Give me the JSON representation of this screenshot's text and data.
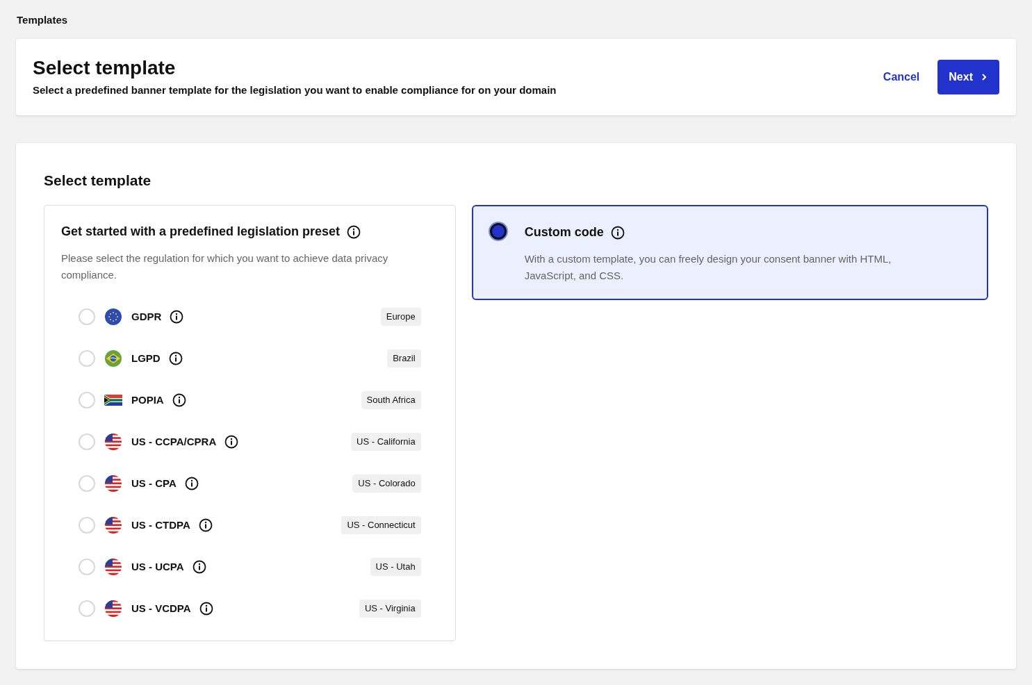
{
  "breadcrumb": "Templates",
  "header": {
    "title": "Select template",
    "subtitle": "Select a predefined banner template for the legislation you want to enable compliance for on your domain",
    "cancel": "Cancel",
    "next": "Next"
  },
  "section_title": "Select template",
  "preset": {
    "title": "Get started with a predefined legislation preset",
    "description": "Please select the regulation for which you want to achieve data privacy compliance.",
    "selected": false,
    "options": [
      {
        "label": "GDPR",
        "region": "Europe",
        "kind": "eu",
        "selected": false
      },
      {
        "label": "LGPD",
        "region": "Brazil",
        "kind": "br",
        "selected": false
      },
      {
        "label": "POPIA",
        "region": "South Africa",
        "kind": "za",
        "selected": false
      },
      {
        "label": "US - CCPA/CPRA",
        "region": "US - California",
        "kind": "us",
        "selected": false
      },
      {
        "label": "US - CPA",
        "region": "US - Colorado",
        "kind": "us",
        "selected": false
      },
      {
        "label": "US - CTDPA",
        "region": "US - Connecticut",
        "kind": "us",
        "selected": false
      },
      {
        "label": "US - UCPA",
        "region": "US - Utah",
        "kind": "us",
        "selected": false
      },
      {
        "label": "US - VCDPA",
        "region": "US - Virginia",
        "kind": "us",
        "selected": false
      }
    ]
  },
  "custom": {
    "title": "Custom code",
    "description": "With a custom template, you can freely design your consent banner with HTML, JavaScript, and CSS.",
    "selected": true
  }
}
